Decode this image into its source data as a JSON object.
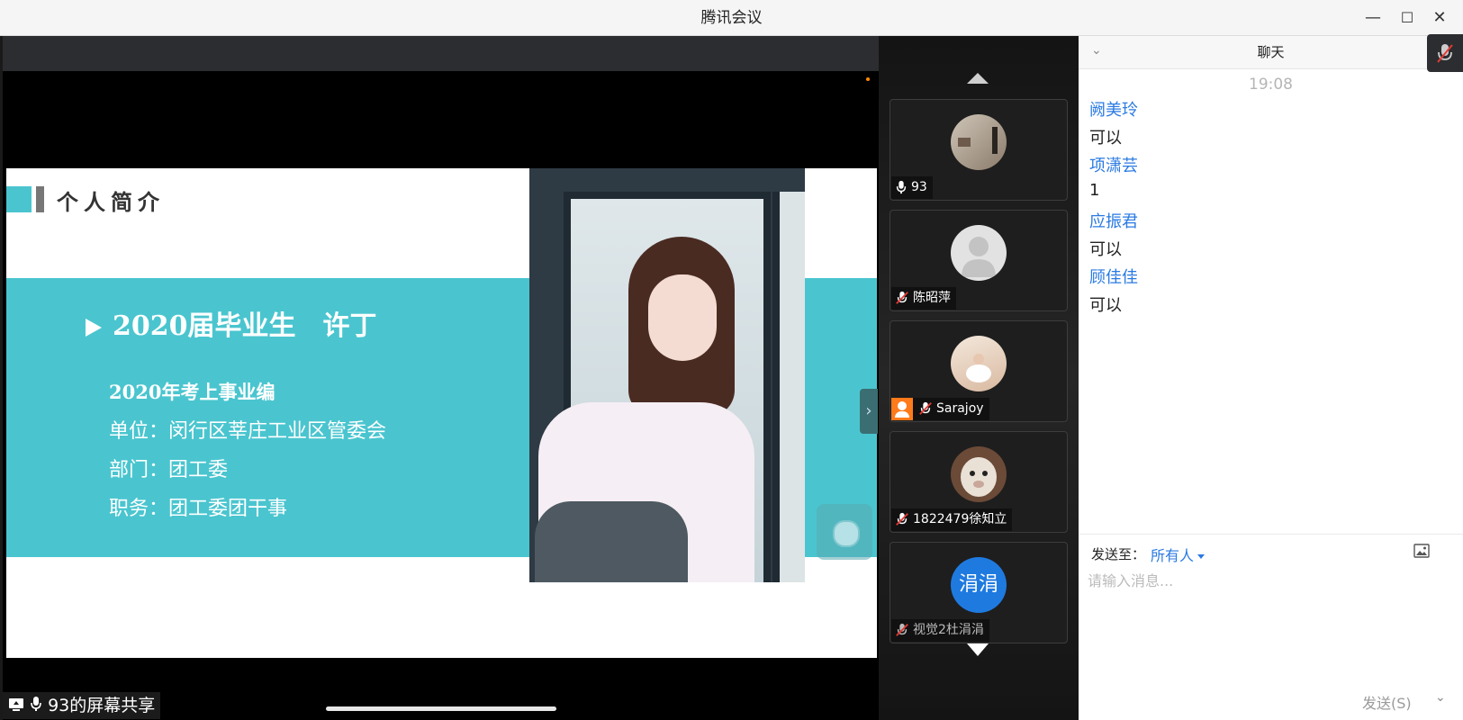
{
  "window": {
    "title": "腾讯会议",
    "minimize": "—",
    "maximize": "☐",
    "close": "✕"
  },
  "slide": {
    "title": "个人简介",
    "headline": "2020届毕业生　许丁",
    "lines": [
      "2020年考上事业编",
      "单位：闵行区莘庄工业区管委会",
      "部门：团工委",
      "职务：团工委团干事"
    ]
  },
  "share": {
    "label": "93的屏幕共享"
  },
  "participants": [
    {
      "name": "93",
      "mic": "on",
      "avatar": "photo"
    },
    {
      "name": "陈昭萍",
      "mic": "muted",
      "avatar": "default"
    },
    {
      "name": "Sarajoy",
      "mic": "muted",
      "avatar": "photo",
      "host": true
    },
    {
      "name": "1822479徐知立",
      "mic": "muted",
      "avatar": "photo"
    },
    {
      "name": "视觉2杜涓涓",
      "mic": "muted",
      "avatar": "text",
      "avatar_text": "涓涓"
    }
  ],
  "chat": {
    "title": "聊天",
    "time": "19:08",
    "messages": [
      {
        "sender": "阙美玲",
        "text": "可以"
      },
      {
        "sender": "项潇芸",
        "text": "1"
      },
      {
        "sender": "应振君",
        "text": "可以"
      },
      {
        "sender": "顾佳佳",
        "text": "可以"
      }
    ],
    "send_to_label": "发送至：",
    "send_to_value": "所有人",
    "input_placeholder": "请输入消息...",
    "send_label": "发送(S)"
  },
  "colors": {
    "accent": "#2a7ae2",
    "slide_teal": "#4ac5cf",
    "host_orange": "#ff7a1a"
  }
}
